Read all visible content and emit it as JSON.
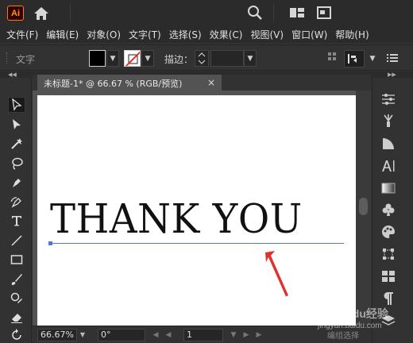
{
  "app": {
    "logo_text": "Ai"
  },
  "menu": {
    "items": [
      "文件(F)",
      "编辑(E)",
      "对象(O)",
      "文字(T)",
      "选择(S)",
      "效果(C)",
      "视图(V)",
      "窗口(W)",
      "帮助(H)"
    ]
  },
  "control_bar": {
    "tool_label": "文字",
    "fill_color": "#000000",
    "stroke_color": "none",
    "stroke_label": "描边："
  },
  "document": {
    "tab_title": "未标题-1* @ 66.67 % (RGB/预览)",
    "close_symbol": "×",
    "text_content": "THANK YOU"
  },
  "status_bar": {
    "zoom": "66.67%",
    "rotation": "0°",
    "page": "1"
  },
  "watermark": {
    "line1": "Baidu经验",
    "line2": "jingyan.baidu.com",
    "line3": "编组选择"
  },
  "colors": {
    "accent_orange": "#ff7c00",
    "selection_blue": "#4a7bd4",
    "arrow_red": "#e0322b"
  }
}
